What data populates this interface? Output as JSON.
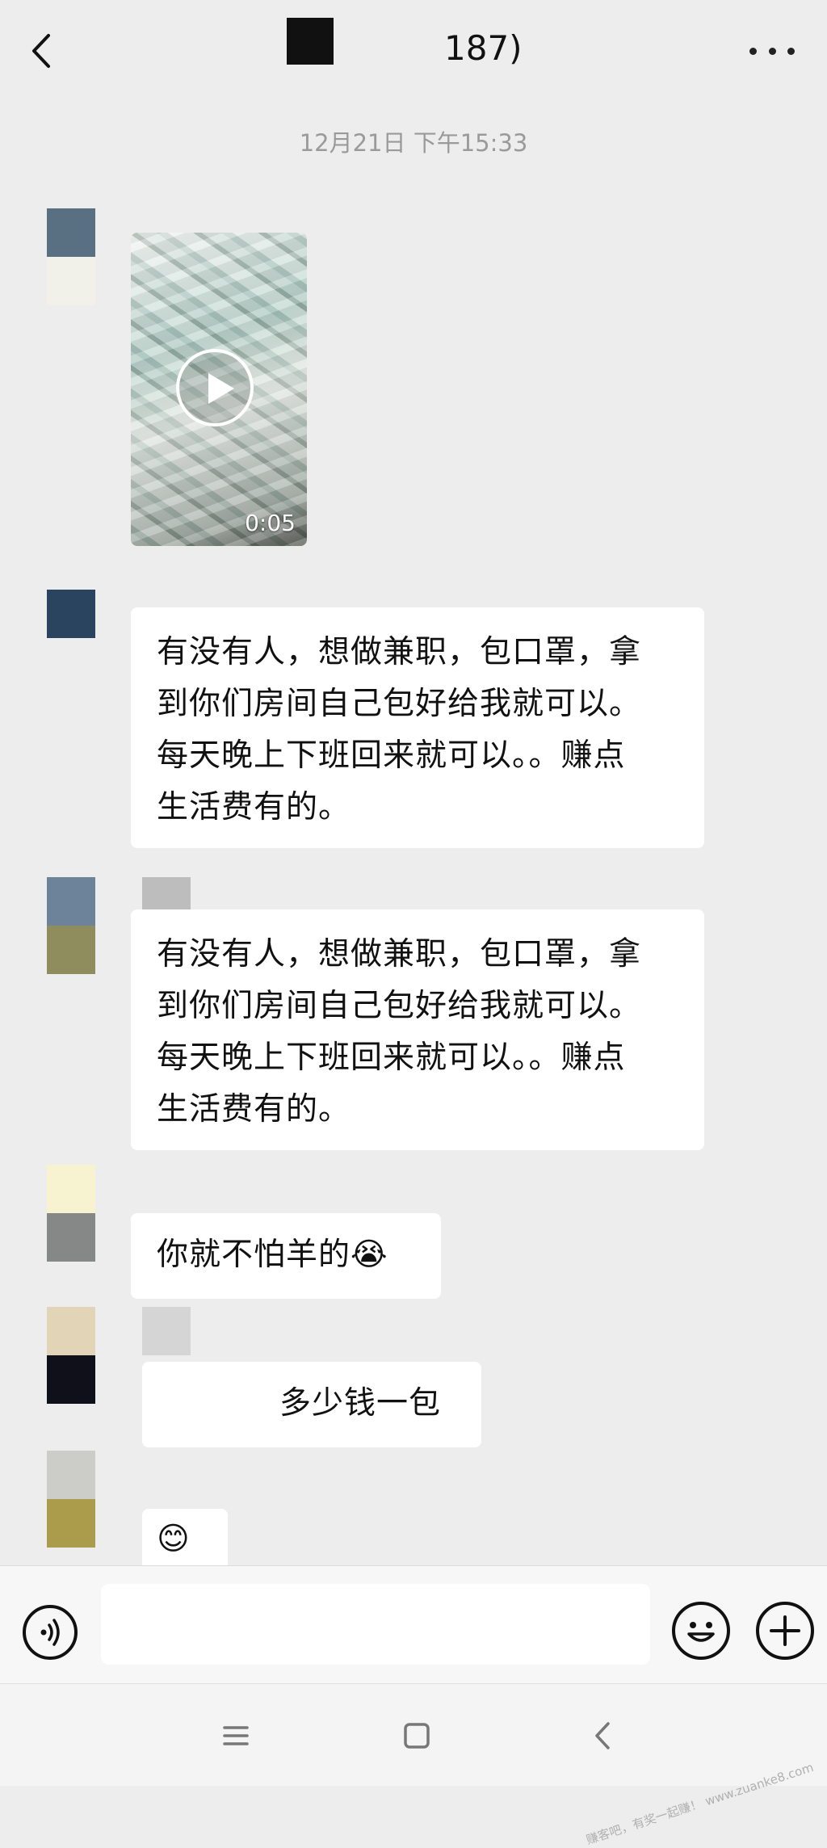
{
  "header": {
    "title": "187)",
    "back_icon": "chevron-left-icon",
    "more_icon": "more-dots-icon"
  },
  "timestamp": "12月21日 下午15:33",
  "messages": {
    "video": {
      "duration": "0:05",
      "icon": "play-icon"
    },
    "m1": {
      "lines": [
        "有没有人，想做兼职，包口罩，拿",
        "到你们房间自己包好给我就可以。",
        "每天晚上下班回来就可以。。赚点",
        "生活费有的。"
      ]
    },
    "m2": {
      "lines": [
        "有没有人，想做兼职，包口罩，拿",
        "到你们房间自己包好给我就可以。",
        "每天晚上下班回来就可以。。赚点",
        "生活费有的。"
      ]
    },
    "m3": {
      "text": "你就不怕羊的",
      "emoji": "😭"
    },
    "m4": {
      "text": "多少钱一包"
    },
    "m5": {
      "emoji": "😊"
    }
  },
  "input_bar": {
    "voice_icon": "voice-icon",
    "message_value": "",
    "emoji_icon": "emoji-icon",
    "plus_icon": "plus-icon"
  },
  "system_nav": {
    "menu_icon": "menu-icon",
    "home_icon": "home-icon",
    "back_icon": "back-icon"
  },
  "watermark": "赚客吧，有奖一起赚！ www.zuanke8.com",
  "colors": {
    "background": "#ededed",
    "bubble": "#ffffff",
    "timestamp": "#9a9a9a"
  }
}
